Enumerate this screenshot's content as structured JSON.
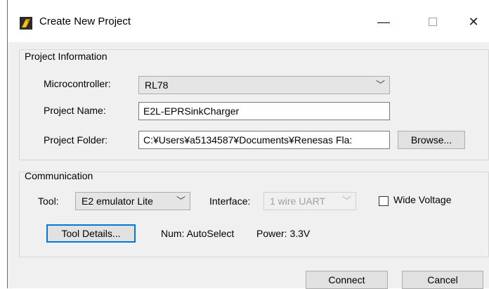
{
  "window": {
    "title": "Create New Project",
    "minimize_glyph": "—",
    "close_glyph": "✕"
  },
  "project_info": {
    "group_label": "Project Information",
    "microcontroller_label": "Microcontroller:",
    "microcontroller_value": "RL78",
    "project_name_label": "Project Name:",
    "project_name_value": "E2L-EPRSinkCharger",
    "project_folder_label": "Project Folder:",
    "project_folder_value": "C:¥Users¥a5134587¥Documents¥Renesas Fla:",
    "browse_label": "Browse..."
  },
  "communication": {
    "group_label": "Communication",
    "tool_label": "Tool:",
    "tool_value": "E2 emulator Lite",
    "interface_label": "Interface:",
    "interface_value": "1 wire UART",
    "wide_voltage_label": "Wide Voltage",
    "wide_voltage_checked": false,
    "tool_details_label": "Tool Details...",
    "num_text": "Num: AutoSelect",
    "power_text": "Power: 3.3V"
  },
  "footer": {
    "connect_label": "Connect",
    "cancel_label": "Cancel"
  },
  "icons": {
    "app": "renesas-flash-programmer-icon",
    "dropdown": "chevron-down-icon"
  }
}
